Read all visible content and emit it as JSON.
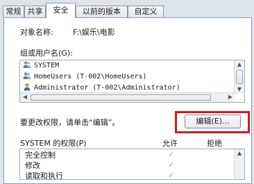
{
  "tabs": [
    "常规",
    "共享",
    "安全",
    "以前的版本",
    "自定义"
  ],
  "active_tab": "安全",
  "object_name_label": "对象名称:",
  "object_name_value": "F:\\娱乐\\电影",
  "group_label": "组或用户名(G):",
  "users": [
    {
      "name": "SYSTEM",
      "icon": "users-icon"
    },
    {
      "name": "HomeUsers (T-002\\HomeUsers)",
      "icon": "users-icon"
    },
    {
      "name": "Administrator (T-002\\Administrator)",
      "icon": "user-icon"
    }
  ],
  "change_perm_text": "要更改权限，请单击“编辑”。",
  "edit_button": "编辑(E)...",
  "perm_title": "SYSTEM 的权限(P)",
  "allow_label": "允许",
  "deny_label": "拒绝",
  "permissions": [
    {
      "name": "完全控制",
      "allow": "✓"
    },
    {
      "name": "修改",
      "allow": "✓"
    },
    {
      "name": "读取和执行",
      "allow": "✓"
    }
  ],
  "colors": {
    "highlight": "#d11a1a",
    "panel": "#ffffff",
    "window": "#dde3ea"
  }
}
